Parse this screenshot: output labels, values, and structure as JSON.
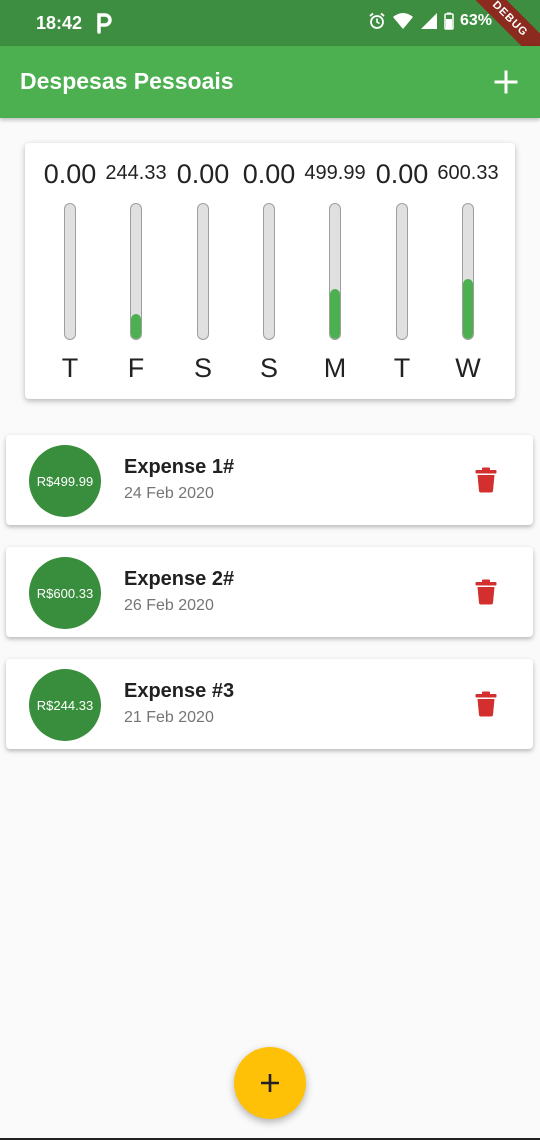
{
  "status_bar": {
    "time": "18:42",
    "battery_percent": "63%",
    "icons": [
      "p-logo-icon",
      "alarm-icon",
      "wifi-icon",
      "signal-icon",
      "battery-icon"
    ]
  },
  "debug_banner": "DEBUG",
  "app_bar": {
    "title": "Despesas Pessoais",
    "add_icon": "plus-icon"
  },
  "chart": {
    "days": [
      {
        "day": "T",
        "value_label": "0.00",
        "fill_fraction": 0.0
      },
      {
        "day": "F",
        "value_label": "244.33",
        "fill_fraction": 0.182
      },
      {
        "day": "S",
        "value_label": "0.00",
        "fill_fraction": 0.0
      },
      {
        "day": "S",
        "value_label": "0.00",
        "fill_fraction": 0.0
      },
      {
        "day": "M",
        "value_label": "499.99",
        "fill_fraction": 0.372
      },
      {
        "day": "T",
        "value_label": "0.00",
        "fill_fraction": 0.0
      },
      {
        "day": "W",
        "value_label": "600.33",
        "fill_fraction": 0.447
      }
    ]
  },
  "transactions": [
    {
      "amount": "R$499.99",
      "title": "Expense 1#",
      "date": "24 Feb 2020",
      "delete_icon": "trash-icon"
    },
    {
      "amount": "R$600.33",
      "title": "Expense 2#",
      "date": "26 Feb 2020",
      "delete_icon": "trash-icon"
    },
    {
      "amount": "R$244.33",
      "title": "Expense #3",
      "date": "21 Feb 2020",
      "delete_icon": "trash-icon"
    }
  ],
  "fab": {
    "icon": "plus-icon"
  },
  "colors": {
    "primary": "#4caf50",
    "primary_dark": "#3e8e41",
    "avatar": "#388e3c",
    "accent": "#ffc107",
    "delete": "#d32f2f"
  }
}
